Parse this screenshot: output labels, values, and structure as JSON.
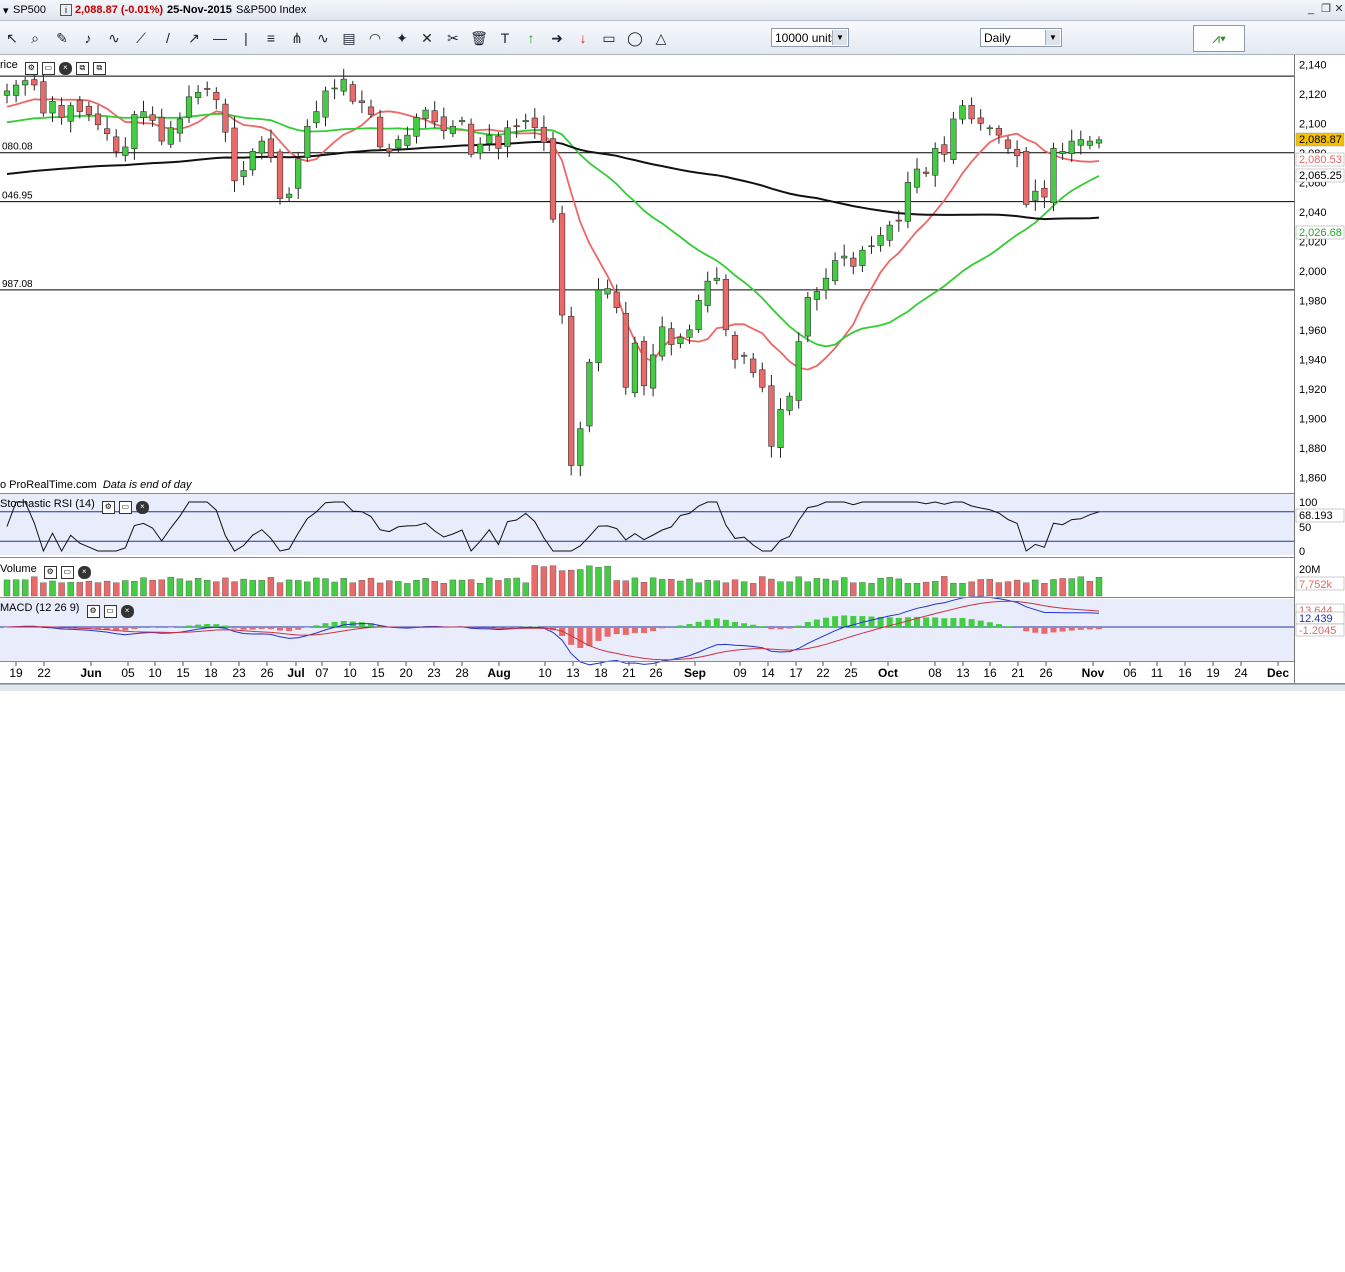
{
  "titlebar": {
    "symbol": "SP500",
    "change": "2,088.87 (-0.01%)",
    "date": "25-Nov-2015",
    "name": "S&P500 Index"
  },
  "toolbar": {
    "units_value": "10000 units",
    "period_value": "Daily",
    "icons": [
      "cursor-icon",
      "zoom-icon",
      "ruler-icon",
      "alert-bell-icon",
      "fan-icon",
      "trend-icon",
      "line-icon",
      "ray-icon",
      "horizontal-line-icon",
      "vertical-line-icon",
      "channel-icon",
      "pitchfork-icon",
      "wave-icon",
      "fibonacci-icon",
      "arc-icon",
      "fib-fan-icon",
      "gann-icon",
      "tools-icon",
      "trash-icon",
      "text-icon",
      "buy-arrow-icon",
      "right-arrow-icon",
      "sell-arrow-icon",
      "rectangle-icon",
      "ellipse-icon",
      "triangle-icon"
    ]
  },
  "price_panel": {
    "label": "rice",
    "hlines": [
      {
        "value": 2132,
        "label": ""
      },
      {
        "value": 2080.08,
        "label": "080.08"
      },
      {
        "value": 2046.95,
        "label": "046.95"
      },
      {
        "value": 1987.08,
        "label": "987.08"
      }
    ],
    "footer_source": "o ProRealTime.com",
    "footer_note": "Data is end of day",
    "badges": [
      {
        "text": "2,088.87",
        "bg": "#f5c000",
        "fg": "#000000"
      },
      {
        "text": "2,080.53",
        "bg": "#ffffff",
        "fg": "#e06a6a"
      },
      {
        "text": "2,065.25",
        "bg": "#ffffff",
        "fg": "#000000"
      },
      {
        "text": "2,026.68",
        "bg": "#ffffff",
        "fg": "#22aa22"
      }
    ]
  },
  "rsi_panel": {
    "label": "Stochastic RSI (14)",
    "last": "68.193",
    "ticks": [
      "100",
      "50",
      "0"
    ]
  },
  "volume_panel": {
    "label": "Volume",
    "top_tick": "20M",
    "last": "7,752k"
  },
  "macd_panel": {
    "label": "MACD (12 26 9)",
    "values": [
      "13.644",
      "12.439",
      "-1.2045"
    ]
  },
  "x_axis_labels": [
    "19",
    "22",
    "Jun",
    "05",
    "10",
    "15",
    "18",
    "23",
    "26",
    "Jul",
    "07",
    "10",
    "15",
    "20",
    "23",
    "28",
    "Aug",
    "10",
    "13",
    "18",
    "21",
    "26",
    "Sep",
    "09",
    "14",
    "17",
    "22",
    "25",
    "Oct",
    "08",
    "13",
    "16",
    "21",
    "26",
    "Nov",
    "06",
    "11",
    "16",
    "19",
    "24",
    "Dec"
  ],
  "colors": {
    "up": "#44cc44",
    "down": "#e86a6a",
    "ma_fast": "#ee6666",
    "ma_mid": "#33cc33",
    "ma_slow": "#111111",
    "panel_bg": "#e8ecfb"
  },
  "chart_data": {
    "type": "candlestick",
    "title": "S&P500 Index",
    "ylim": [
      1850,
      2145
    ],
    "y_ticks": [
      2140,
      2120,
      2100,
      2080,
      2060,
      2040,
      2020,
      2000,
      1980,
      1960,
      1940,
      1920,
      1900,
      1880,
      1860
    ],
    "ohlc_close_sequence": [
      2122,
      2126,
      2129,
      2126,
      2107,
      2115,
      2104,
      2112,
      2108,
      2106,
      2099,
      2093,
      2081,
      2084,
      2106,
      2108,
      2102,
      2088,
      2097,
      2103,
      2118,
      2121,
      2123,
      2116,
      2094,
      2061,
      2068,
      2081,
      2088,
      2077,
      2049,
      2052,
      2076,
      2098,
      2108,
      2122,
      2124,
      2130,
      2115,
      2114,
      2106,
      2084,
      2081,
      2089,
      2092,
      2104,
      2109,
      2101,
      2095,
      2098,
      2102,
      2079,
      2086,
      2092,
      2083,
      2097,
      2098,
      2102,
      2097,
      2087,
      2035,
      1970,
      1868,
      1893,
      1938,
      1987,
      1988,
      1975,
      1921,
      1951,
      1922,
      1943,
      1962,
      1950,
      1955,
      1960,
      1980,
      1993,
      1995,
      1960,
      1940,
      1942,
      1931,
      1921,
      1881,
      1906,
      1915,
      1952,
      1982,
      1986,
      1995,
      2007,
      2010,
      2003,
      2014,
      2017,
      2024,
      2031,
      2034,
      2060,
      2069,
      2066,
      2083,
      2079,
      2103,
      2112,
      2103,
      2100,
      2097,
      2092,
      2083,
      2078,
      2045,
      2054,
      2050,
      2083,
      2081,
      2088,
      2089,
      2088,
      2088.87
    ],
    "series": [
      {
        "name": "",
        "last": 2080.53
      },
      {
        "name": "",
        "last": 2026.68
      },
      {
        "name": "",
        "last": 2065.25
      }
    ]
  }
}
